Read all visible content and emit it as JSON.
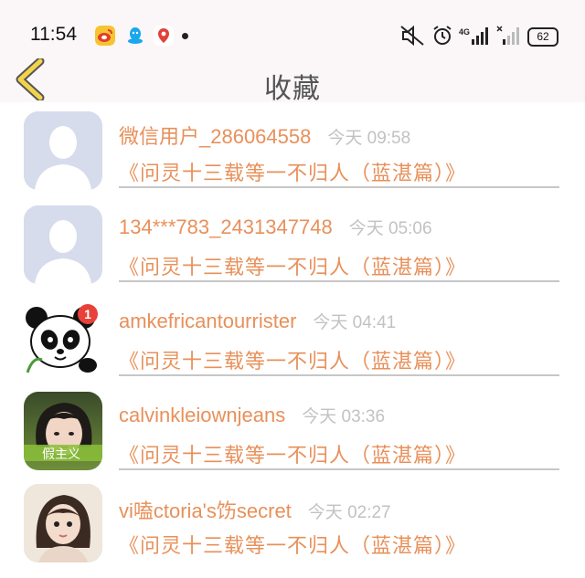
{
  "status_bar": {
    "time": "11:54",
    "battery": "62",
    "network": "4G"
  },
  "header": {
    "title": "收藏",
    "back_icon": "chevron-left-icon"
  },
  "colors": {
    "accent": "#e8905a",
    "back_arrow_fill": "#f3d34a",
    "muted_text": "#c2c2c2",
    "separator": "#c7c7c7"
  },
  "favorites": [
    {
      "user": "微信用户_286064558",
      "time": "今天 09:58",
      "book": "《问灵十三载等一不归人（蓝湛篇）》",
      "avatar": "default-avatar"
    },
    {
      "user": "134***783_2431347748",
      "time": "今天 05:06",
      "book": "《问灵十三载等一不归人（蓝湛篇）》",
      "avatar": "default-avatar"
    },
    {
      "user": "amkefricantourrister",
      "time": "今天 04:41",
      "book": "《问灵十三载等一不归人（蓝湛篇）》",
      "avatar": "panda-avatar",
      "badge": "1"
    },
    {
      "user": "calvinkleiownjeans",
      "time": "今天 03:36",
      "book": "《问灵十三载等一不归人（蓝湛篇）》",
      "avatar": "girl-photo-avatar",
      "avatar_caption": "假主义"
    },
    {
      "user": "vi嗑ctoria's饬secret",
      "time": "今天 02:27",
      "book": "《问灵十三载等一不归人（蓝湛篇）》",
      "avatar": "child-photo-avatar"
    }
  ]
}
